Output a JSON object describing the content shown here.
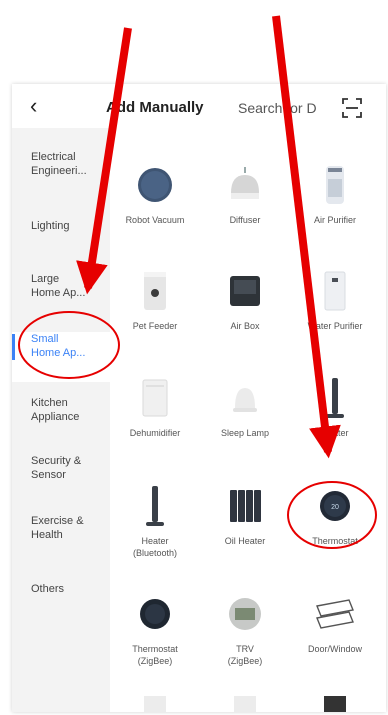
{
  "header": {
    "title": "Add Manually",
    "search_placeholder": "Search for D"
  },
  "sidebar": {
    "items": [
      {
        "label": "Electrical\nEngineeri..."
      },
      {
        "label": "Lighting"
      },
      {
        "label": "Large\nHome Ap..."
      },
      {
        "label": "Small\nHome Ap...",
        "active": true
      },
      {
        "label": "Kitchen\nAppliance"
      },
      {
        "label": "Security &\nSensor"
      },
      {
        "label": "Exercise &\nHealth"
      },
      {
        "label": "Others"
      }
    ]
  },
  "devices": [
    {
      "label": "Robot Vacuum",
      "icon": "robot-vacuum-icon"
    },
    {
      "label": "Diffuser",
      "icon": "diffuser-icon"
    },
    {
      "label": "Air Purifier",
      "icon": "air-purifier-icon"
    },
    {
      "label": "Pet Feeder",
      "icon": "pet-feeder-icon"
    },
    {
      "label": "Air Box",
      "icon": "air-box-icon"
    },
    {
      "label": "Water Purifier",
      "icon": "water-purifier-icon"
    },
    {
      "label": "Dehumidifier",
      "icon": "dehumidifier-icon"
    },
    {
      "label": "Sleep Lamp",
      "icon": "sleep-lamp-icon"
    },
    {
      "label": "Heater",
      "icon": "heater-icon"
    },
    {
      "label": "Heater\n(Bluetooth)",
      "icon": "heater-bluetooth-icon"
    },
    {
      "label": "Oil Heater",
      "icon": "oil-heater-icon"
    },
    {
      "label": "Thermostat",
      "icon": "thermostat-icon"
    },
    {
      "label": "Thermostat\n(ZigBee)",
      "icon": "thermostat-zigbee-icon"
    },
    {
      "label": "TRV\n(ZigBee)",
      "icon": "trv-icon"
    },
    {
      "label": "Door/Window",
      "icon": "door-window-icon"
    }
  ],
  "colors": {
    "accent": "#3b82f6",
    "annotation": "#e60000"
  }
}
